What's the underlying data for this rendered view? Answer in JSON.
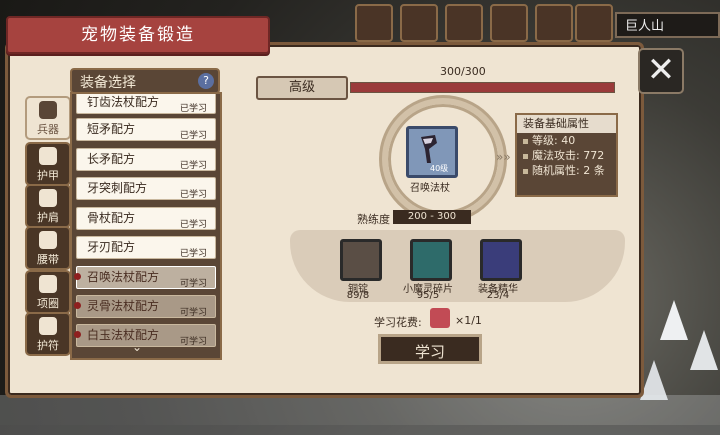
{
  "window": {
    "title": "宠物装备锻造",
    "map_name": "巨人山"
  },
  "tabs": [
    {
      "label": "兵器",
      "active": true
    },
    {
      "label": "护甲",
      "active": false
    },
    {
      "label": "护肩",
      "active": false
    },
    {
      "label": "腰带",
      "active": false
    },
    {
      "label": "项圈",
      "active": false
    },
    {
      "label": "护符",
      "active": false
    }
  ],
  "list": {
    "header": "装备选择",
    "help_icon": "?",
    "items": [
      {
        "name": "钉齿法杖配方",
        "status": "已学习"
      },
      {
        "name": "短矛配方",
        "status": "已学习"
      },
      {
        "name": "长矛配方",
        "status": "已学习"
      },
      {
        "name": "牙突刺配方",
        "status": "已学习"
      },
      {
        "name": "骨杖配方",
        "status": "已学习"
      },
      {
        "name": "牙刃配方",
        "status": "已学习"
      },
      {
        "name": "召唤法杖配方",
        "status": "可学习"
      },
      {
        "name": "灵骨法杖配方",
        "status": "可学习"
      },
      {
        "name": "白玉法杖配方",
        "status": "可学习"
      }
    ]
  },
  "grade": {
    "label": "高级",
    "progress_text": "300/300",
    "progress": 1.0
  },
  "item": {
    "level": "40级",
    "name": "召唤法杖"
  },
  "attributes": {
    "title": "装备基础属性",
    "rows": [
      "等级: 40",
      "魔法攻击: 772",
      "随机属性: 2 条"
    ]
  },
  "proficiency": {
    "label": "熟练度",
    "value": "200 - 300"
  },
  "materials": [
    {
      "name": "铜锭",
      "count": "89/8",
      "color": "#5a4e45",
      "icon": "copper-ingot-icon"
    },
    {
      "name": "小魔灵碎片",
      "count": "95/5",
      "color": "#2e6b6a",
      "icon": "crystal-shard-icon"
    },
    {
      "name": "装备精华",
      "count": "23/4",
      "color": "#3a3d7a",
      "icon": "essence-icon"
    }
  ],
  "cost": {
    "label": "学习花费:",
    "value": "×1/1"
  },
  "learn_button": "学习",
  "close_icon": "✕",
  "colors": {
    "title_ribbon": "#a6433f",
    "progress_fill": "#9a3a3a",
    "panel_bg": "#efe4d2"
  }
}
